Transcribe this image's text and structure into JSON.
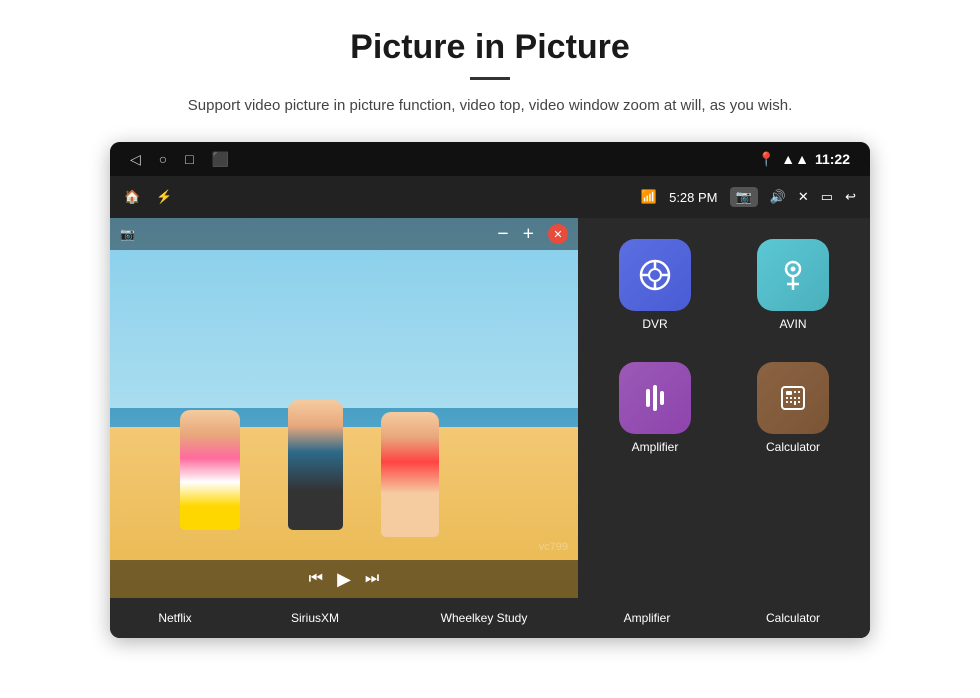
{
  "header": {
    "title": "Picture in Picture",
    "subtitle": "Support video picture in picture function, video top, video window zoom at will, as you wish."
  },
  "status_bar": {
    "time": "11:22",
    "pip_time": "5:28 PM",
    "nav_back": "◁",
    "nav_home": "○",
    "nav_recent": "□",
    "nav_extra": "⬛"
  },
  "pip_controls": {
    "minus": "−",
    "plus": "+",
    "close": "✕",
    "prev": "⏮",
    "play": "▶",
    "next": "⏭"
  },
  "apps": [
    {
      "id": "netflix",
      "label": "Netflix",
      "icon": "▶",
      "color_class": "icon-netflix"
    },
    {
      "id": "siriusxm",
      "label": "SiriusXM",
      "icon": "📡",
      "color_class": "icon-siriusxm"
    },
    {
      "id": "wheelkey",
      "label": "Wheelkey Study",
      "icon": "🔑",
      "color_class": "icon-wheelkey"
    },
    {
      "id": "dvr",
      "label": "DVR",
      "icon": "◎",
      "color_class": "icon-dvr"
    },
    {
      "id": "avin",
      "label": "AVIN",
      "icon": "🔌",
      "color_class": "icon-avin"
    },
    {
      "id": "amplifier",
      "label": "Amplifier",
      "icon": "🎚",
      "color_class": "icon-amplifier"
    },
    {
      "id": "calculator",
      "label": "Calculator",
      "icon": "🖩",
      "color_class": "icon-calculator"
    }
  ],
  "watermark": "vc799"
}
